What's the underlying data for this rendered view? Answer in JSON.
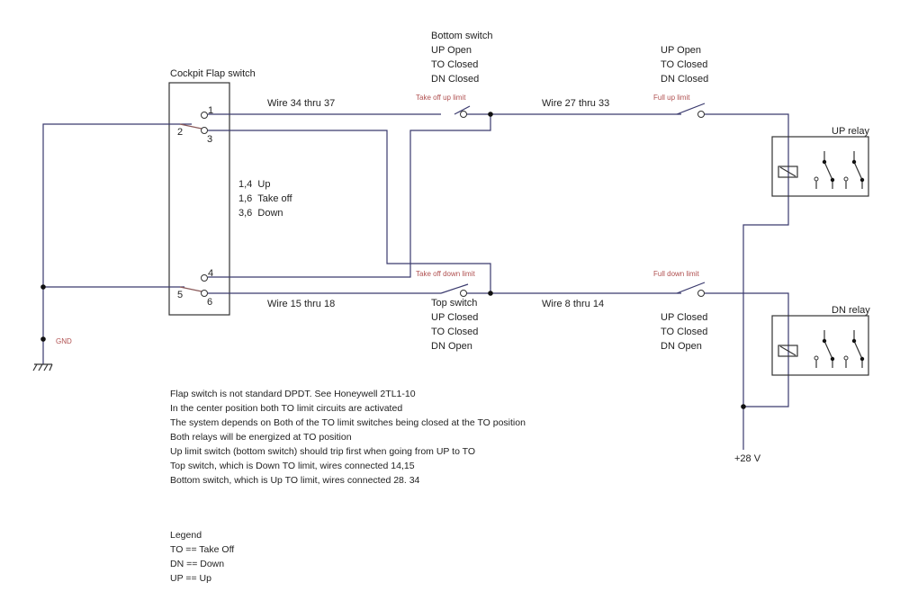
{
  "colors": {
    "wire": "#3a3a6e",
    "wire_light": "#7a7aa8",
    "limit_label": "#b05050",
    "text": "#222222",
    "box": "#333333"
  },
  "flap_switch": {
    "title": "Cockpit Flap switch",
    "terminals": [
      "1",
      "2",
      "3",
      "4",
      "5",
      "6"
    ],
    "positions": [
      "1,4  Up",
      "1,6  Take off",
      "3,6  Down"
    ]
  },
  "wires": {
    "upper_left": "Wire 34 thru 37",
    "upper_right": "Wire 27 thru 33",
    "lower_left": "Wire 15 thru 18",
    "lower_right": "Wire 8 thru 14"
  },
  "limit_switches": {
    "take_off_up": "Take off up limit",
    "full_up": "Full up limit",
    "take_off_down": "Take off down limit",
    "full_down": "Full down limit"
  },
  "bottom_switch": [
    "Bottom switch",
    "UP Open",
    "TO Closed",
    "DN Closed"
  ],
  "full_up_states": [
    "UP Open",
    "TO Closed",
    "DN Closed"
  ],
  "top_switch": [
    "Top switch",
    "UP Closed",
    "TO Closed",
    "DN Open"
  ],
  "full_down_states": [
    "UP Closed",
    "TO Closed",
    "DN Open"
  ],
  "relays": {
    "up": "UP relay",
    "down": "DN relay"
  },
  "power": "+28 V",
  "ground": "GND",
  "notes": [
    "Flap switch is not standard DPDT. See Honeywell 2TL1-10",
    "In the center position both TO limit circuits are activated",
    "The system depends on Both of the TO limit switches being closed at the TO position",
    "Both relays will be energized at TO position",
    "Up limit switch (bottom switch) should trip first when going from UP to TO",
    "Top switch, which is Down TO limit, wires connected 14,15",
    "Bottom switch, which is Up TO limit, wires connected 28. 34"
  ],
  "legend": {
    "title": "Legend",
    "items": [
      "TO == Take Off",
      "DN == Down",
      "UP == Up"
    ]
  }
}
